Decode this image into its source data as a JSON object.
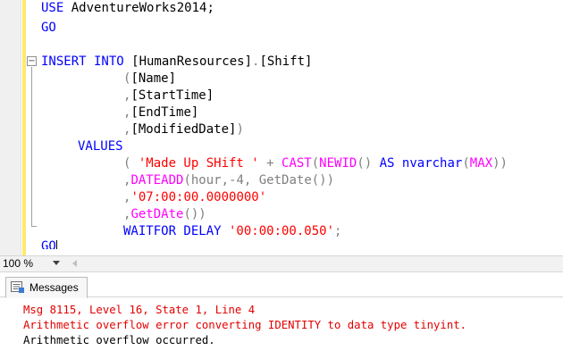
{
  "editor": {
    "lines": {
      "use_kw": "USE",
      "use_db": " AdventureWorks2014;",
      "go1": "GO",
      "insert_kw": "INSERT INTO",
      "insert_table": " [HumanResources]",
      "insert_dot": ".",
      "insert_shift": "[Shift]",
      "col1": "([Name]",
      "col2": ",[StartTime]",
      "col3": ",[EndTime]",
      "col4": ",[ModifiedDate])",
      "values_kw": "VALUES",
      "v1_open": "( ",
      "v1_str": "'Made Up SHift '",
      "v1_plus": " + ",
      "v1_cast": "CAST",
      "v1_paren": "(",
      "v1_newid": "NEWID",
      "v1_parens": "() ",
      "v1_as": "AS",
      "v1_nvarchar": " nvarchar",
      "v1_paren2": "(",
      "v1_max": "MAX",
      "v1_close": "))",
      "v2_comma": ",",
      "v2_dateadd": "DATEADD",
      "v2_rest": "(hour,-4, GetDate())",
      "v3_comma": ",",
      "v3_str": "'07:00:00.0000000'",
      "v4_comma": ",",
      "v4_getdate": "GetDAte",
      "v4_close": "())",
      "wait_kw": "WAITFOR DELAY",
      "wait_str": " '00:00:00.050'",
      "wait_semi": ";",
      "go2": "GO"
    },
    "collapse_glyph": "−"
  },
  "zoom": {
    "value": "100 %"
  },
  "results": {
    "tab_label": "Messages",
    "messages": [
      "Msg 8115, Level 16, State 1, Line 4",
      "Arithmetic overflow error converting IDENTITY to data type tinyint.",
      "Arithmetic overflow occurred."
    ]
  },
  "colors": {
    "keyword": "#0000ff",
    "function": "#ff00ff",
    "string": "#ff0000",
    "error_text": "#e30000"
  }
}
